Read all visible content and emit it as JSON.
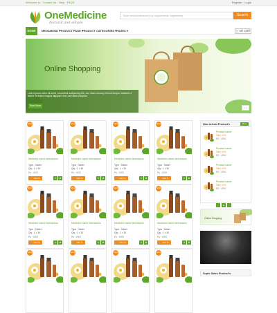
{
  "topbar": {
    "left": "Welcome to · Contact Us · Help · FAQS",
    "right": "Register · Login"
  },
  "logo": {
    "name": "OneMedicine",
    "tagline": "Natural and simple"
  },
  "search": {
    "placeholder": "Enter product keyword (e.g. supplements, vegetables)",
    "button": "Search"
  },
  "nav": {
    "items": [
      "HOME",
      "MEGAMENU PRODUCT PAGE",
      "PRODUCT CATEGORIES",
      "PAGES"
    ],
    "cart": "MY CART"
  },
  "hero": {
    "title": "Online Shopping",
    "caption": "Lorem ipsum dolor sit amet, consetetur sadipscing elitr, sed diam nonumy eirmod tempor invidunt ut labore et dolore magna aliquyam erat, sed diam voluptua.",
    "read_more": "Read More",
    "bag_label": "OneMedicine"
  },
  "products": [
    {
      "sale": "SALE",
      "name": "Medicine name farensarea",
      "type": "Type : Tablet",
      "qty": "Qty : 1 × 30",
      "price": "Rs : 4000",
      "add": "Add To Cart"
    },
    {
      "sale": "SALE",
      "name": "Medicine name farensarea",
      "type": "Type : Tablet",
      "qty": "Qty : 1 × 30",
      "price": "Rs : 4000",
      "add": "Add To Cart"
    },
    {
      "sale": "SALE",
      "name": "Medicine name farensarea",
      "type": "Type : Tablet",
      "qty": "Qty : 1 × 30",
      "price": "Rs : 4000",
      "add": "Add To Cart"
    },
    {
      "sale": "SALE",
      "name": "Medicine name farensarea",
      "type": "Type : Tablet",
      "qty": "Qty : 1 × 30",
      "price": "Rs : 4000",
      "add": "Add To Cart"
    },
    {
      "sale": "SALE",
      "name": "Medicine name farensarea",
      "type": "Type : Tablet",
      "qty": "Qty : 1 × 30",
      "price": "Rs : 4000",
      "add": "Add To Cart"
    },
    {
      "sale": "SALE",
      "name": "Medicine name farensarea",
      "type": "Type : Tablet",
      "qty": "Qty : 1 × 30",
      "price": "Rs : 4000",
      "add": "Add To Cart"
    },
    {
      "sale": "SALE",
      "name": "Medicine name farensarea",
      "type": "Type : Tablet",
      "qty": "Qty : 1 × 30",
      "price": "Rs : 4000",
      "add": "Add To Cart"
    },
    {
      "sale": "SALE",
      "name": "Medicine name farensarea",
      "type": "Type : Tablet",
      "qty": "Qty : 1 × 30",
      "price": "Rs : 4000",
      "add": "Add To Cart"
    },
    {
      "sale": "SALE"
    },
    {
      "sale": "SALE"
    },
    {
      "sale": "SALE"
    },
    {
      "sale": "SALE"
    }
  ],
  "new_arrival": {
    "title": "New Arrival Product's",
    "more": "More",
    "items": [
      {
        "name": "Product name",
        "offer": "Offer 40%",
        "price": "RS : 4000"
      },
      {
        "name": "Product name",
        "offer": "Offer 40%",
        "price": "RS : 4000"
      },
      {
        "name": "Product name",
        "offer": "Offer 40%",
        "price": "RS : 4000"
      },
      {
        "name": "Product name",
        "offer": "Offer 40%",
        "price": "RS : 4000"
      }
    ]
  },
  "banner1": {
    "text": "Online Shopping"
  },
  "super_sales": {
    "title": "Super Sales Product's"
  },
  "colors": {
    "green": "#5ea52b",
    "orange": "#f28b1b"
  }
}
